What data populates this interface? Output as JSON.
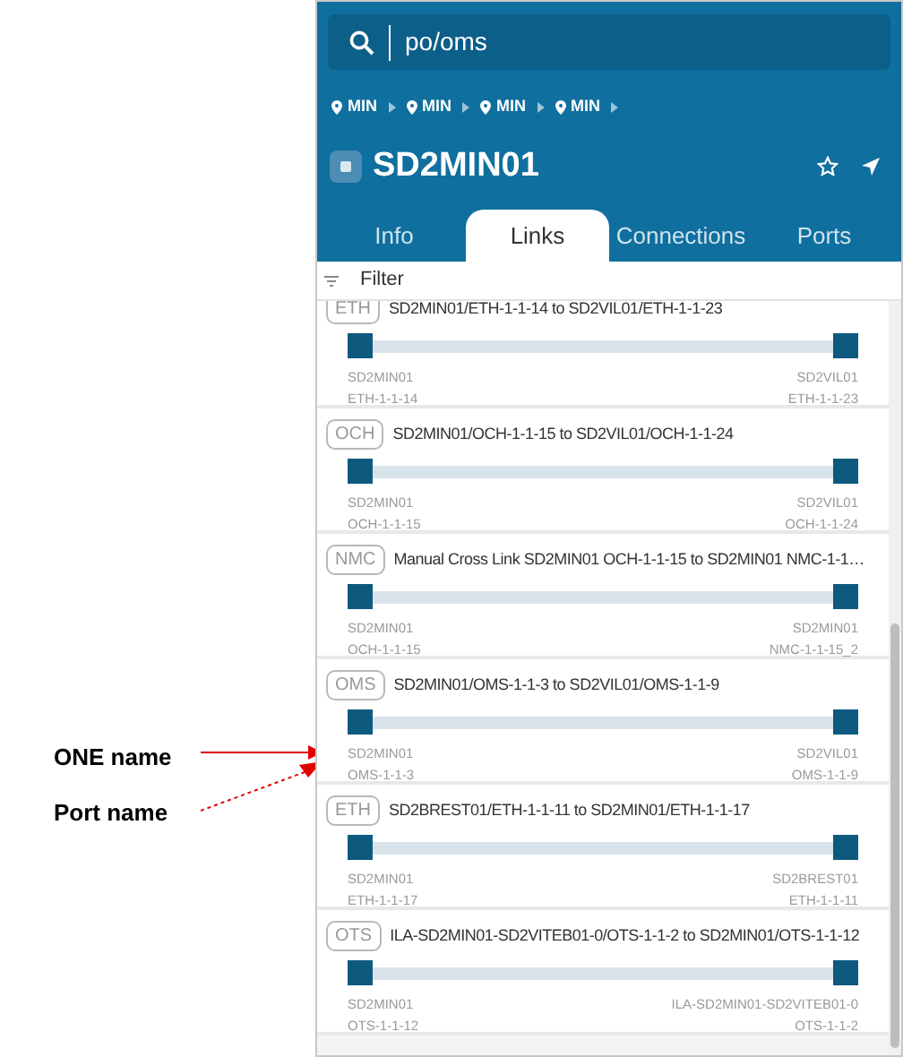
{
  "search": {
    "value": "po/oms"
  },
  "breadcrumbs": [
    "MIN",
    "MIN",
    "MIN",
    "MIN"
  ],
  "title": "SD2MIN01",
  "tabs": [
    {
      "label": "Info",
      "selected": false
    },
    {
      "label": "Links",
      "selected": true
    },
    {
      "label": "Connections",
      "selected": false
    },
    {
      "label": "Ports",
      "selected": false
    }
  ],
  "filter": {
    "label": "Filter"
  },
  "links": [
    {
      "type": "ETH",
      "title": "SD2MIN01/ETH-1-1-14 to SD2VIL01/ETH-1-1-23",
      "a_node": "SD2MIN01",
      "a_port": "ETH-1-1-14",
      "z_node": "SD2VIL01",
      "z_port": "ETH-1-1-23"
    },
    {
      "type": "OCH",
      "title": "SD2MIN01/OCH-1-1-15 to SD2VIL01/OCH-1-1-24",
      "a_node": "SD2MIN01",
      "a_port": "OCH-1-1-15",
      "z_node": "SD2VIL01",
      "z_port": "OCH-1-1-24"
    },
    {
      "type": "NMC",
      "title": "Manual Cross Link SD2MIN01 OCH-1-1-15 to SD2MIN01 NMC-1-1…",
      "a_node": "SD2MIN01",
      "a_port": "OCH-1-1-15",
      "z_node": "SD2MIN01",
      "z_port": "NMC-1-1-15_2"
    },
    {
      "type": "OMS",
      "title": "SD2MIN01/OMS-1-1-3 to SD2VIL01/OMS-1-1-9",
      "a_node": "SD2MIN01",
      "a_port": "OMS-1-1-3",
      "z_node": "SD2VIL01",
      "z_port": "OMS-1-1-9"
    },
    {
      "type": "ETH",
      "title": "SD2BREST01/ETH-1-1-11 to SD2MIN01/ETH-1-1-17",
      "a_node": "SD2MIN01",
      "a_port": "ETH-1-1-17",
      "z_node": "SD2BREST01",
      "z_port": "ETH-1-1-11"
    },
    {
      "type": "OTS",
      "title": "ILA-SD2MIN01-SD2VITEB01-0/OTS-1-1-2 to SD2MIN01/OTS-1-1-12",
      "a_node": "SD2MIN01",
      "a_port": "OTS-1-1-12",
      "z_node": "ILA-SD2MIN01-SD2VITEB01-0",
      "z_port": "OTS-1-1-2"
    }
  ],
  "annotations": [
    {
      "kind": "solid",
      "text": "ONE name"
    },
    {
      "kind": "dotted",
      "text": "Port name"
    }
  ]
}
